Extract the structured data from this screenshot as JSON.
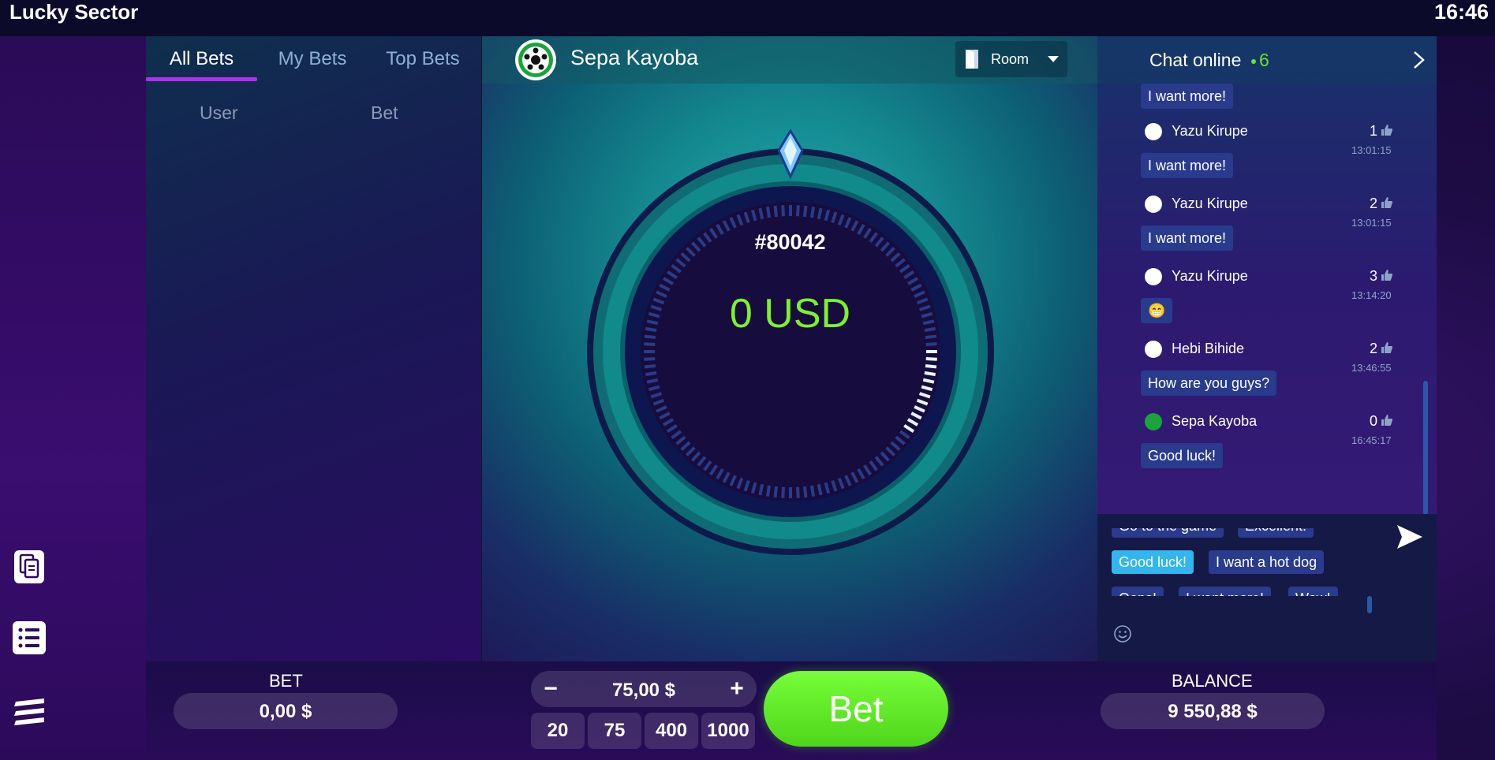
{
  "app": {
    "title": "Lucky Sector",
    "clock": "16:46"
  },
  "bets_panel": {
    "tabs": [
      {
        "label": "All Bets",
        "active": true
      },
      {
        "label": "My Bets",
        "active": false
      },
      {
        "label": "Top Bets",
        "active": false
      }
    ],
    "columns": [
      "User",
      "Bet"
    ]
  },
  "game": {
    "player_name": "Sepa Kayoba",
    "room_label": "Room",
    "round_id": "#80042",
    "win_amount": "0 USD",
    "progress_fraction": 0.1
  },
  "chat": {
    "title": "Chat online",
    "online_count": "6",
    "messages": [
      {
        "user": "",
        "likes": "",
        "time": "",
        "text": "I want more!"
      },
      {
        "user": "Yazu Kirupe",
        "likes": "1",
        "time": "13:01:15",
        "text": "I want more!"
      },
      {
        "user": "Yazu Kirupe",
        "likes": "2",
        "time": "13:01:15",
        "text": "I want more!"
      },
      {
        "user": "Yazu Kirupe",
        "likes": "3",
        "time": "13:14:20",
        "text": "😁"
      },
      {
        "user": "Hebi Bihide",
        "likes": "2",
        "time": "13:46:55",
        "text": "How are you guys?"
      },
      {
        "user": "Sepa Kayoba",
        "likes": "0",
        "time": "16:45:17",
        "text": "Good luck!"
      }
    ],
    "quick_messages": {
      "row_top": [
        "Go to the game",
        "Excellent!"
      ],
      "row_main": [
        "Good luck!",
        "I want a hot dog"
      ],
      "row_bottom": [
        "Oops!",
        "I want more!",
        "Wow!"
      ]
    }
  },
  "bottom": {
    "bet_label": "BET",
    "bet_value": "0,00 $",
    "stake_value": "75,00 $",
    "presets": [
      "20",
      "75",
      "400",
      "1000"
    ],
    "bet_button": "Bet",
    "balance_label": "BALANCE",
    "balance_value": "9 550,88 $"
  },
  "colors": {
    "accent_green": "#7cf22a",
    "tab_underline": "#b030f0",
    "bubble": "#2a3b8e",
    "quick_active": "#31b6ee"
  }
}
